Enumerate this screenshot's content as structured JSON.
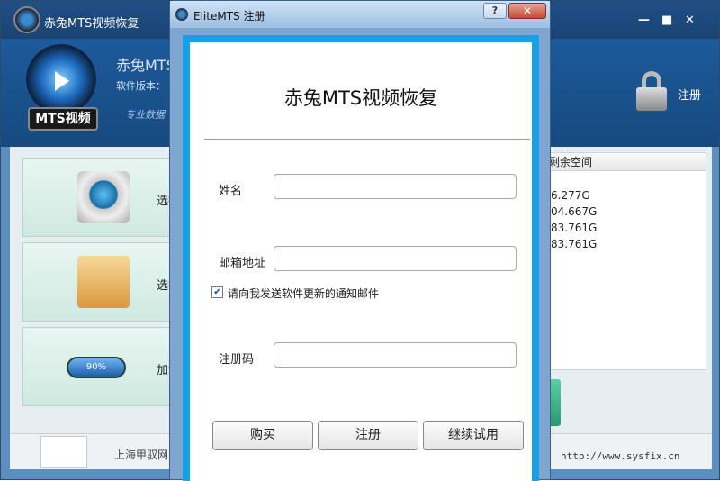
{
  "window": {
    "title": "赤兔MTS视频恢复",
    "logo_badge": "MTS视频",
    "app_name": "赤兔MTS",
    "version": "软件版本：",
    "slogan": "专业数据",
    "register_label": "注册"
  },
  "sidebar": {
    "items": [
      {
        "label": "选择",
        "icon": "disk-icon"
      },
      {
        "label": "选择",
        "icon": "folder-icon"
      },
      {
        "label": "加载",
        "icon": "progress-icon",
        "progress_text": "90%"
      }
    ]
  },
  "drive_table": {
    "header": "剩余空间",
    "rows": [
      "6.277G",
      "04.667G",
      "83.761G",
      "83.761G"
    ]
  },
  "footer": {
    "company": "上海甲驭网",
    "website": "http://www.sysfix.cn"
  },
  "dialog": {
    "title": "EliteMTS 注册",
    "help_label": "?",
    "close_label": "✕",
    "heading": "赤兔MTS视频恢复",
    "name_label": "姓名",
    "name_value": "",
    "email_label": "邮箱地址",
    "email_value": "",
    "newsletter_checked": true,
    "newsletter_label": "请向我发送软件更新的通知邮件",
    "code_label": "注册码",
    "code_value": "",
    "buttons": {
      "buy": "购买",
      "register": "注册",
      "trial": "继续试用"
    }
  },
  "colors": {
    "dialog_frame": "#16a0e6",
    "header_bg": "#1d5a9a"
  }
}
